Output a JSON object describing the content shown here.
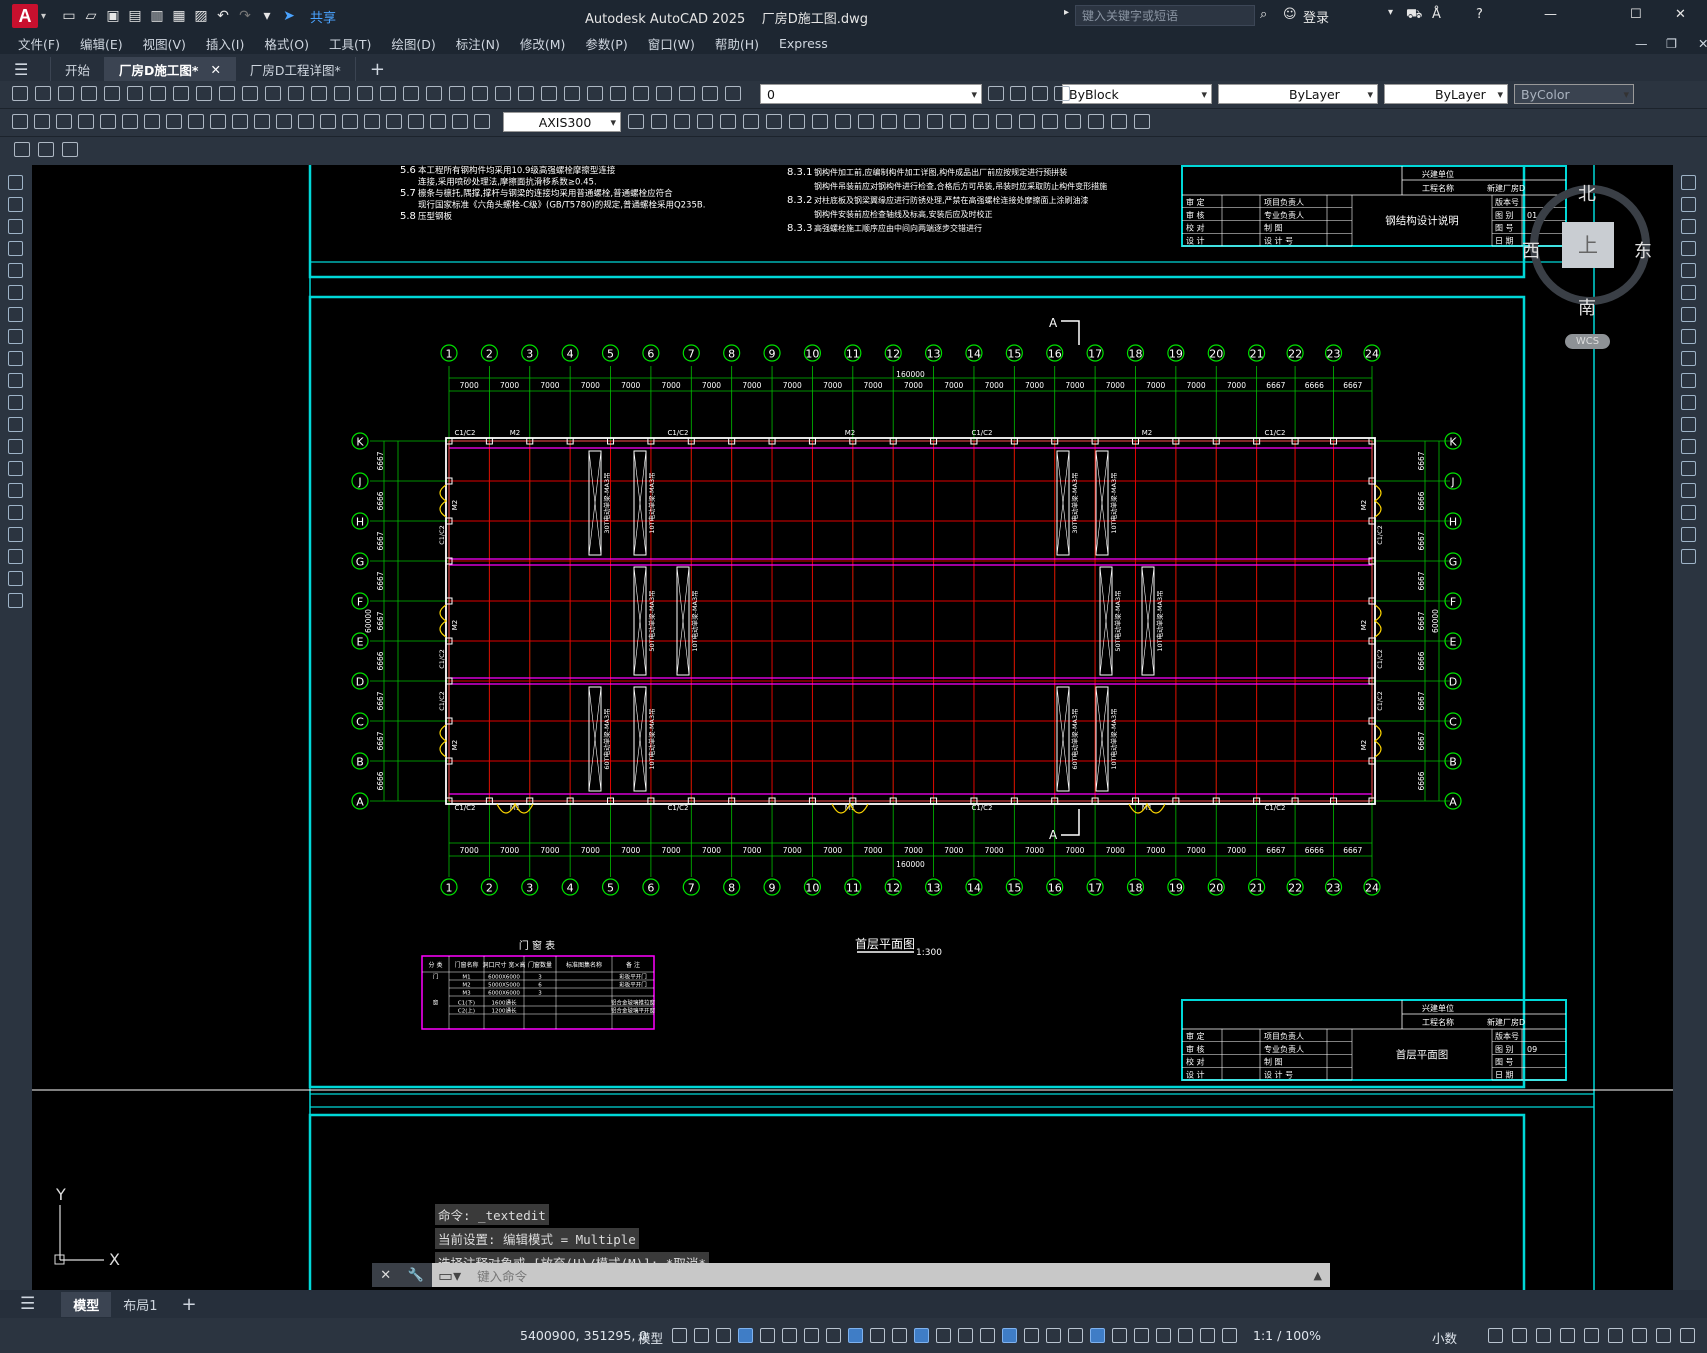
{
  "app": {
    "logo": "A",
    "share": "共享",
    "title": "Autodesk AutoCAD 2025    厂房D施工图.dwg",
    "search_placeholder": "键入关键字或短语",
    "login": "登录"
  },
  "menu": [
    "文件(F)",
    "编辑(E)",
    "视图(V)",
    "插入(I)",
    "格式(O)",
    "工具(T)",
    "绘图(D)",
    "标注(N)",
    "修改(M)",
    "参数(P)",
    "窗口(W)",
    "帮助(H)",
    "Express"
  ],
  "doc_tabs": [
    {
      "label": "开始",
      "active": false
    },
    {
      "label": "厂房D施工图*",
      "active": true
    },
    {
      "label": "厂房D工程详图*",
      "active": false
    }
  ],
  "toolbar": {
    "layer_value": "0",
    "color_value": "ByBlock",
    "linetype_value": "ByLayer",
    "lineweight_value": "ByLayer",
    "plotstyle_value": "ByColor",
    "dimstyle_value": "AXIS300"
  },
  "navcube": {
    "north": "北",
    "south": "南",
    "east": "东",
    "west": "西",
    "top": "上",
    "wcs": "WCS"
  },
  "drawing": {
    "notes_left": [
      {
        "num": "5.6",
        "text": "本工程所有钢构件均采用10.9级高强螺栓摩擦型连接"
      },
      {
        "num": "",
        "text": "连接,采用喷砂处理法,摩擦面抗滑移系数≥0.45."
      },
      {
        "num": "5.7",
        "text": "檩条与檩托,隅撑,撑杆与钢梁的连接均采用普通螺栓,普通螺栓应符合"
      },
      {
        "num": "",
        "text": "现行国家标准《六角头螺栓-C级》(GB/T5780)的规定,普通螺栓采用Q235B."
      },
      {
        "num": "5.8",
        "text": "压型钢板"
      }
    ],
    "notes_right": [
      {
        "num": "8.3.1",
        "text": "钢构件加工前,应编制构件加工详图,构件成品出厂前应按规定进行预拼装"
      },
      {
        "num": "",
        "text": "钢构件吊装前应对钢构件进行检查,合格后方可吊装,吊装时应采取防止构件变形措施"
      },
      {
        "num": "8.3.2",
        "text": "对柱底板及钢梁翼缘应进行防锈处理,严禁在高强螺栓连接处摩擦面上涂刷油漆"
      },
      {
        "num": "",
        "text": "钢构件安装前应检查轴线及标高,安装后应及时校正"
      },
      {
        "num": "8.3.3",
        "text": "高强螺栓施工顺序应由中间向两端逐步交错进行"
      }
    ],
    "title_block_top": {
      "unit_label": "兴建单位",
      "project_label": "工程名称",
      "project_value": "新建厂房D",
      "drawing_name": "钢结构设计说明",
      "rows": [
        [
          "审 定",
          "项目负责人"
        ],
        [
          "审 核",
          "专业负责人"
        ],
        [
          "校 对",
          "制 图"
        ],
        [
          "设 计",
          "设 计 号"
        ]
      ],
      "right_rows": [
        "版本号",
        "图 别",
        "图 号",
        "日 期"
      ],
      "number": "01"
    },
    "title_block_bottom": {
      "unit_label": "兴建单位",
      "project_label": "工程名称",
      "project_value": "新建厂房D",
      "drawing_name": "首层平面图",
      "rows": [
        [
          "审 定",
          "项目负责人"
        ],
        [
          "审 核",
          "专业负责人"
        ],
        [
          "校 对",
          "制 图"
        ],
        [
          "设 计",
          "设 计 号"
        ]
      ],
      "right_rows": [
        "版本号",
        "图 别",
        "图 号",
        "日 期"
      ],
      "number": "09"
    },
    "plan_title": "首层平面图",
    "plan_scale": "1:300",
    "section_mark": "A",
    "total_length": "160000",
    "total_width": "60000",
    "col_axes": [
      "1",
      "2",
      "3",
      "4",
      "5",
      "6",
      "7",
      "8",
      "9",
      "10",
      "11",
      "12",
      "13",
      "14",
      "15",
      "16",
      "17",
      "18",
      "19",
      "20",
      "21",
      "22",
      "23",
      "24"
    ],
    "col_spacings": [
      "7000",
      "7000",
      "7000",
      "7000",
      "7000",
      "7000",
      "7000",
      "7000",
      "7000",
      "7000",
      "7000",
      "7000",
      "7000",
      "7000",
      "7000",
      "7000",
      "7000",
      "7000",
      "7000",
      "7000",
      "6667",
      "6666",
      "6667"
    ],
    "row_axes": [
      "K",
      "J",
      "H",
      "G",
      "F",
      "E",
      "D",
      "C",
      "B",
      "A"
    ],
    "row_spacings": [
      "6667",
      "6666",
      "6667",
      "6667",
      "6667",
      "6666",
      "6667",
      "6667",
      "6666",
      "6667"
    ],
    "door_labels": {
      "m1": "M1",
      "m2": "M2",
      "c1c2": "C1/C2"
    },
    "crane_labels": [
      "30T电动单梁-MA3吊",
      "10T电动单梁-MA3吊",
      "50T电动单梁-MA3吊",
      "10T电动单梁-MA3吊",
      "60T电动单梁-MA3吊",
      "10T电动单梁-MA3吊"
    ],
    "door_table": {
      "title": "门 窗 表",
      "headers": [
        "分 类",
        "门窗名称",
        "洞口尺寸 宽×高",
        "门窗数量",
        "标准图集名称",
        "备 注"
      ],
      "rows": [
        [
          "门",
          "M1",
          "6000X6000",
          "3",
          "",
          "彩板平开门"
        ],
        [
          "",
          "M2",
          "5000X5000",
          "6",
          "",
          "彩板平开门"
        ],
        [
          "",
          "M3",
          "6000X6000",
          "3",
          "",
          ""
        ],
        [
          "窗",
          "C1(下)",
          "1600通长",
          "",
          "",
          "铝合金玻璃推拉窗"
        ],
        [
          "",
          "C2(上)",
          "1200通长",
          "",
          "",
          "铝合金玻璃平开窗"
        ]
      ]
    }
  },
  "command": {
    "lines": [
      "命令: _textedit",
      "当前设置: 编辑模式 = Multiple",
      "选择注释对象或 [放弃(U)/模式(M)]: *取消*"
    ],
    "placeholder": "键入命令"
  },
  "layout_tabs": [
    {
      "label": "模型",
      "active": true
    },
    {
      "label": "布局1",
      "active": false
    }
  ],
  "status": {
    "coords": "5400900, 351295, 0",
    "model": "模型",
    "scale": "1:1 / 100%",
    "units": "小数"
  },
  "ucs": {
    "x": "X",
    "y": "Y"
  }
}
